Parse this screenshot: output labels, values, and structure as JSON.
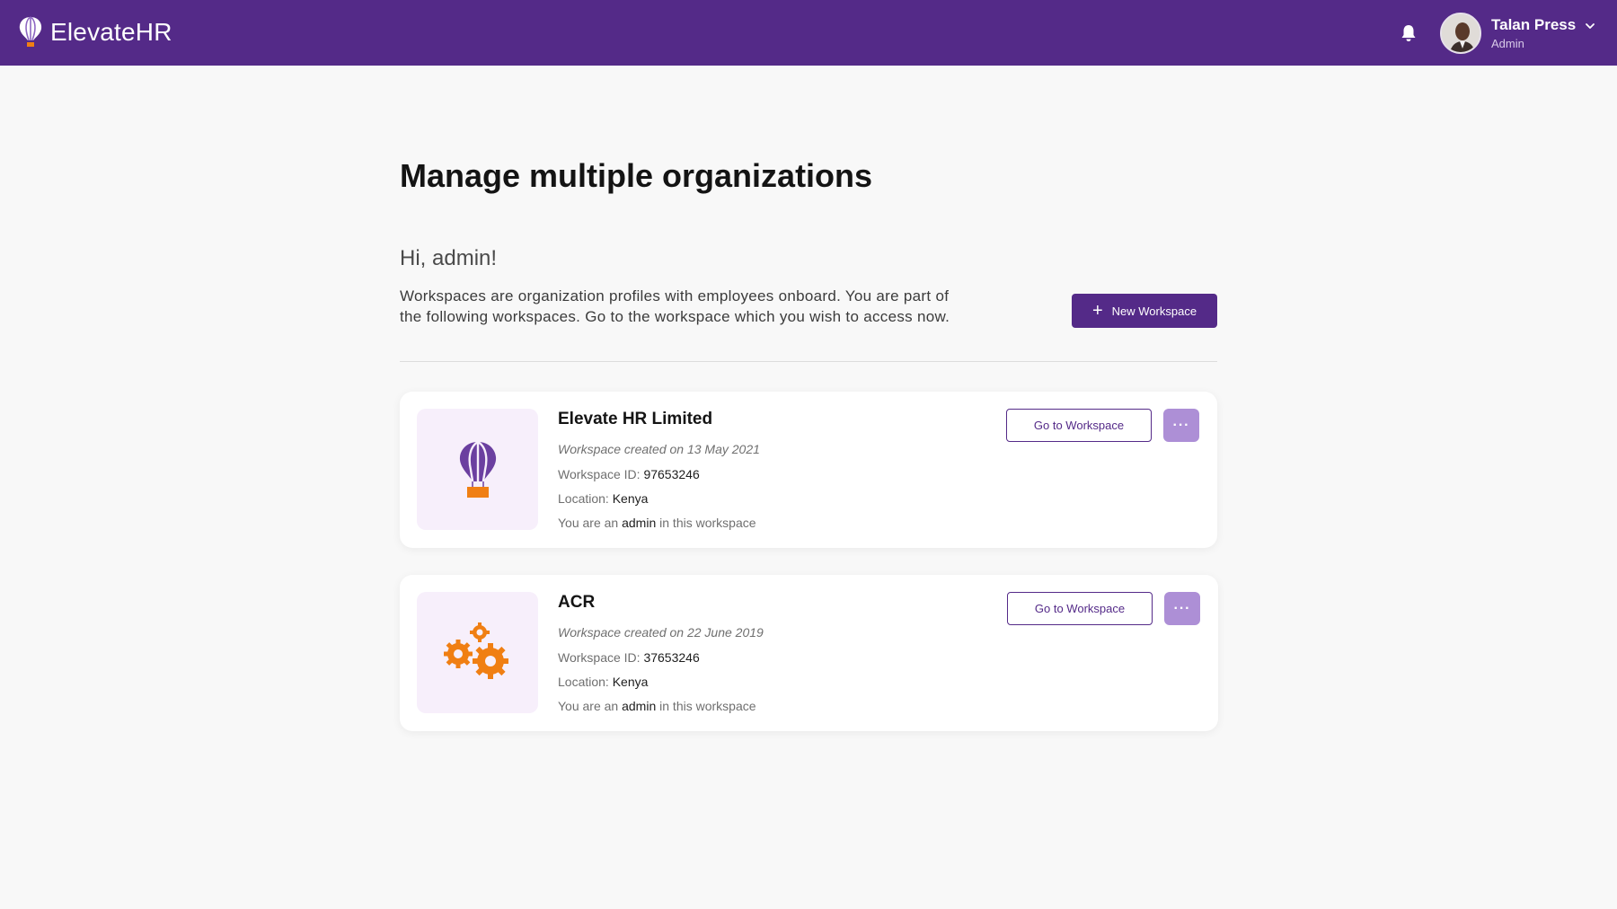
{
  "app": {
    "brand_name": "ElevateHR",
    "brand_color": "#542a88",
    "accent_orange": "#f07f13",
    "logo_icon": "balloon-icon"
  },
  "header": {
    "notification_icon": "bell-icon",
    "user": {
      "name": "Talan Press",
      "role": "Admin",
      "menu_icon": "chevron-down-icon"
    }
  },
  "main": {
    "title": "Manage multiple organizations",
    "greeting": "Hi, admin!",
    "intro_line1": "Workspaces are organization profiles with employees onboard. You are part of",
    "intro_line2": "the following workspaces. Go to the workspace which you wish to access now.",
    "new_workspace_label": "New Workspace",
    "new_workspace_icon": "plus-icon"
  },
  "workspaces": [
    {
      "name": "Elevate HR Limited",
      "logo": "balloon-icon",
      "created": "Workspace created on 13 May 2021",
      "id_label": "Workspace ID: ",
      "id_value": "97653246",
      "location_label": "Location: ",
      "location_value": "Kenya",
      "role_prefix": "You are an ",
      "role_value": "admin",
      "role_suffix": " in this workspace",
      "go_label": "Go to Workspace",
      "more_label": "···"
    },
    {
      "name": "ACR",
      "logo": "gears-icon",
      "created": "Workspace created on 22 June 2019",
      "id_label": "Workspace ID: ",
      "id_value": "37653246",
      "location_label": "Location: ",
      "location_value": "Kenya",
      "role_prefix": "You are an ",
      "role_value": "admin",
      "role_suffix": " in this workspace",
      "go_label": "Go to Workspace",
      "more_label": "···"
    }
  ]
}
